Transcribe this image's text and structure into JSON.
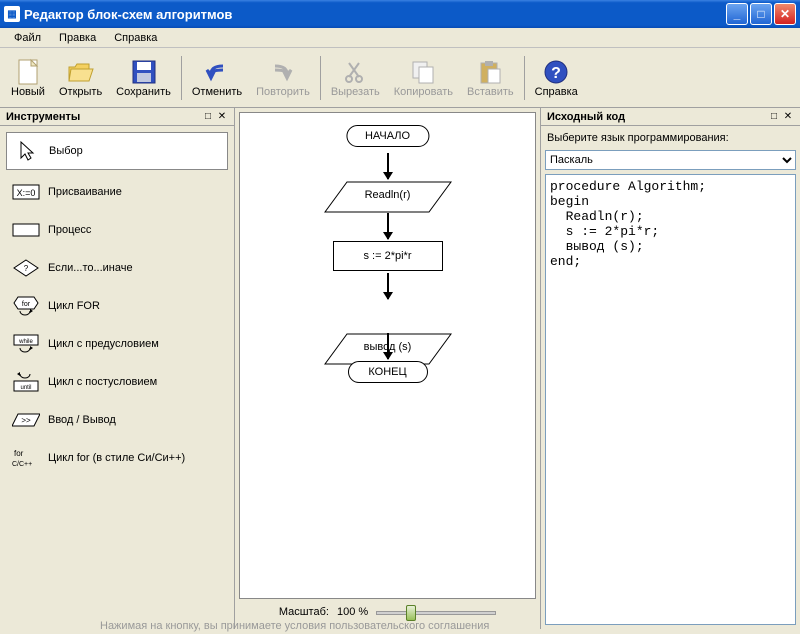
{
  "window": {
    "title": "Редактор блок-схем алгоритмов"
  },
  "menu": {
    "file": "Файл",
    "edit": "Правка",
    "help": "Справка"
  },
  "toolbar": {
    "new": "Новый",
    "open": "Открыть",
    "save": "Сохранить",
    "undo": "Отменить",
    "redo": "Повторить",
    "cut": "Вырезать",
    "copy": "Копировать",
    "paste": "Вставить",
    "help": "Справка"
  },
  "panels": {
    "tools": {
      "title": "Инструменты"
    },
    "code": {
      "title": "Исходный код",
      "lang_label": "Выберите язык программирования:",
      "lang_selected": "Паскаль"
    }
  },
  "tools": {
    "select": "Выбор",
    "assign": "Присваивание",
    "process": "Процесс",
    "ifelse": "Если...то...иначе",
    "for": "Цикл FOR",
    "while": "Цикл с предусловием",
    "until": "Цикл с постусловием",
    "io": "Ввод / Вывод",
    "cfor": "Цикл for (в стиле Си/Си++)"
  },
  "flowchart": {
    "start": "НАЧАЛО",
    "input": "Readln(r)",
    "process": "s := 2*pi*r",
    "output": "вывод (s)",
    "end": "КОНЕЦ"
  },
  "zoom": {
    "label": "Масштаб:",
    "value": "100 %"
  },
  "code_text": "procedure Algorithm;\nbegin\n  Readln(r);\n  s := 2*pi*r;\n  вывод (s);\nend;",
  "footer": "Нажимая на кнопку, вы принимаете условия пользовательского соглашения",
  "chart_data": {
    "type": "flowchart",
    "nodes": [
      {
        "id": 1,
        "type": "terminator",
        "text": "НАЧАЛО"
      },
      {
        "id": 2,
        "type": "io",
        "text": "Readln(r)"
      },
      {
        "id": 3,
        "type": "process",
        "text": "s := 2*pi*r"
      },
      {
        "id": 4,
        "type": "io",
        "text": "вывод (s)"
      },
      {
        "id": 5,
        "type": "terminator",
        "text": "КОНЕЦ"
      }
    ],
    "edges": [
      {
        "from": 1,
        "to": 2
      },
      {
        "from": 2,
        "to": 3
      },
      {
        "from": 3,
        "to": 4
      },
      {
        "from": 4,
        "to": 5
      }
    ]
  }
}
